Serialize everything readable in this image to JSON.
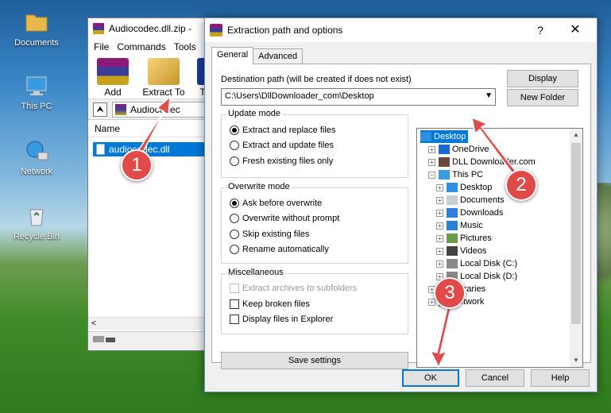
{
  "desktop": {
    "icons": [
      {
        "label": "Documents",
        "icon": "folder-icon"
      },
      {
        "label": "This PC",
        "icon": "computer-icon"
      },
      {
        "label": "Network",
        "icon": "network-icon"
      },
      {
        "label": "Recycle Bin",
        "icon": "recycle-bin-icon"
      }
    ]
  },
  "winrar": {
    "title": "Audiocodec.dll.zip -",
    "menu": [
      "File",
      "Commands",
      "Tools"
    ],
    "toolbar": {
      "add_label": "Add",
      "extract_label": "Extract To",
      "third_label": "T"
    },
    "address": "Audiocodec",
    "list_header": "Name",
    "selected_file": "audiocodec.dll",
    "hscroll_left": "<"
  },
  "dialog": {
    "title": "Extraction path and options",
    "help_glyph": "?",
    "close_glyph": "✕",
    "tabs": {
      "general": "General",
      "advanced": "Advanced"
    },
    "dest_label": "Destination path (will be created if does not exist)",
    "dest_value": "C:\\Users\\DllDownloader_com\\Desktop",
    "display_btn": "Display",
    "new_folder_btn": "New Folder",
    "update_mode": {
      "title": "Update mode",
      "options": [
        "Extract and replace files",
        "Extract and update files",
        "Fresh existing files only"
      ],
      "selected": 0
    },
    "overwrite_mode": {
      "title": "Overwrite mode",
      "options": [
        "Ask before overwrite",
        "Overwrite without prompt",
        "Skip existing files",
        "Rename automatically"
      ],
      "selected": 0
    },
    "misc": {
      "title": "Miscellaneous",
      "options": [
        "Extract archives to subfolders",
        "Keep broken files",
        "Display files in Explorer"
      ]
    },
    "save_settings_btn": "Save settings",
    "tree": [
      {
        "label": "Desktop",
        "level": 0,
        "expander": "",
        "selected": true
      },
      {
        "label": "OneDrive",
        "level": 1,
        "expander": "+"
      },
      {
        "label": "DLL Downloader.com",
        "level": 1,
        "expander": "+"
      },
      {
        "label": "This PC",
        "level": 1,
        "expander": "−"
      },
      {
        "label": "Desktop",
        "level": 2,
        "expander": "+"
      },
      {
        "label": "Documents",
        "level": 2,
        "expander": "+"
      },
      {
        "label": "Downloads",
        "level": 2,
        "expander": "+"
      },
      {
        "label": "Music",
        "level": 2,
        "expander": "+"
      },
      {
        "label": "Pictures",
        "level": 2,
        "expander": "+"
      },
      {
        "label": "Videos",
        "level": 2,
        "expander": "+"
      },
      {
        "label": "Local Disk (C:)",
        "level": 2,
        "expander": "+"
      },
      {
        "label": "Local Disk (D:)",
        "level": 2,
        "expander": "+"
      },
      {
        "label": "Libraries",
        "level": 1,
        "expander": "+"
      },
      {
        "label": "Network",
        "level": 1,
        "expander": "+"
      }
    ],
    "ok_btn": "OK",
    "cancel_btn": "Cancel",
    "help_btn": "Help"
  },
  "annotations": {
    "step1": "1",
    "step2": "2",
    "step3": "3",
    "color": "#e04a4a"
  }
}
